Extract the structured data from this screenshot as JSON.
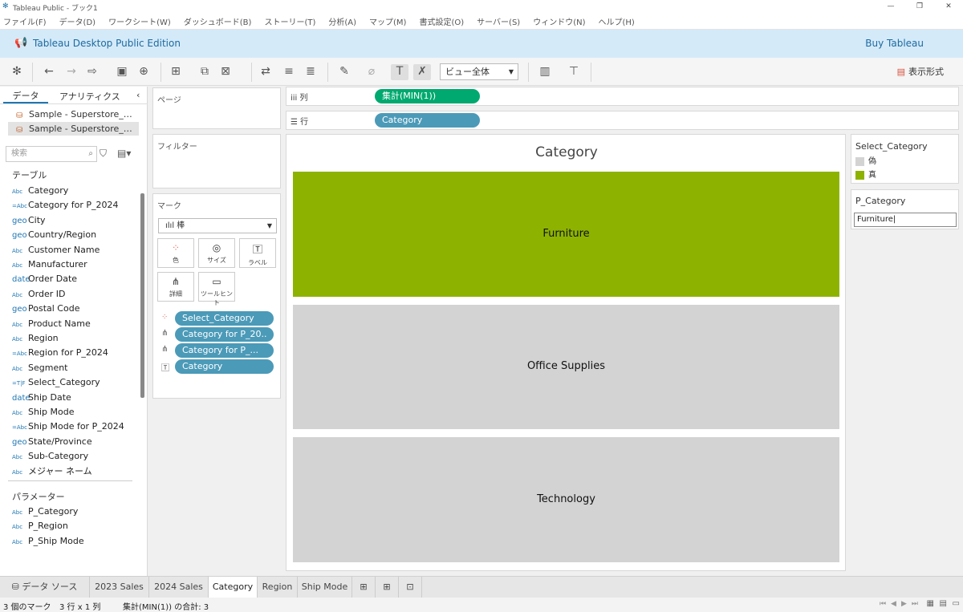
{
  "window": {
    "title": "Tableau Public - ブック1"
  },
  "menu": [
    "ファイル(F)",
    "データ(D)",
    "ワークシート(W)",
    "ダッシュボード(B)",
    "ストーリー(T)",
    "分析(A)",
    "マップ(M)",
    "書式設定(O)",
    "サーバー(S)",
    "ウィンドウ(N)",
    "ヘルプ(H)"
  ],
  "edition": {
    "label": "Tableau Desktop Public Edition",
    "buy": "Buy Tableau"
  },
  "toolbar": {
    "view_select": "ビュー全体",
    "show_me": "表示形式"
  },
  "data_panel": {
    "tab_data": "データ",
    "tab_analytics": "アナリティクス",
    "datasources": [
      "Sample - Superstore_…",
      "Sample - Superstore_…"
    ],
    "search_placeholder": "検索",
    "tables_header": "テーブル",
    "fields": [
      {
        "type": "Abc",
        "name": "Category"
      },
      {
        "type": "=Abc",
        "name": "Category for P_2024"
      },
      {
        "type": "geo",
        "name": "City"
      },
      {
        "type": "geo",
        "name": "Country/Region"
      },
      {
        "type": "Abc",
        "name": "Customer Name"
      },
      {
        "type": "Abc",
        "name": "Manufacturer"
      },
      {
        "type": "date",
        "name": "Order Date"
      },
      {
        "type": "Abc",
        "name": "Order ID"
      },
      {
        "type": "geo",
        "name": "Postal Code"
      },
      {
        "type": "Abc",
        "name": "Product Name"
      },
      {
        "type": "Abc",
        "name": "Region"
      },
      {
        "type": "=Abc",
        "name": "Region for P_2024"
      },
      {
        "type": "Abc",
        "name": "Segment"
      },
      {
        "type": "=T|F",
        "name": "Select_Category"
      },
      {
        "type": "date",
        "name": "Ship Date"
      },
      {
        "type": "Abc",
        "name": "Ship Mode"
      },
      {
        "type": "=Abc",
        "name": "Ship Mode for P_2024"
      },
      {
        "type": "geo",
        "name": "State/Province"
      },
      {
        "type": "Abc",
        "name": "Sub-Category"
      },
      {
        "type": "Abc",
        "name": "メジャー ネーム"
      }
    ],
    "params_header": "パラメーター",
    "params": [
      {
        "type": "Abc",
        "name": "P_Category"
      },
      {
        "type": "Abc",
        "name": "P_Region"
      },
      {
        "type": "Abc",
        "name": "P_Ship Mode"
      }
    ]
  },
  "cards": {
    "pages": "ページ",
    "filters": "フィルター",
    "marks": "マーク",
    "mark_type": "棒",
    "mark_buttons": [
      {
        "icon": "●",
        "label": "色"
      },
      {
        "icon": "◎",
        "label": "サイズ"
      },
      {
        "icon": "T",
        "label": "ラベル"
      },
      {
        "icon": "⋔",
        "label": "詳細"
      },
      {
        "icon": "▭",
        "label": "ツールヒント"
      }
    ],
    "mark_pills": [
      "Select_Category",
      "Category for P_20..",
      "Category for P_...",
      "Category"
    ]
  },
  "shelves": {
    "columns_label": "列",
    "columns_pill": "集計(MIN(1))",
    "rows_label": "行",
    "rows_pill": "Category"
  },
  "viz": {
    "title": "Category"
  },
  "chart_data": {
    "type": "bar",
    "title": "Category",
    "categories": [
      "Furniture",
      "Office Supplies",
      "Technology"
    ],
    "values": [
      1,
      1,
      1
    ],
    "color_field": "Select_Category",
    "colors_by_category": [
      "#8db300",
      "#d3d3d3",
      "#d3d3d3"
    ],
    "xlabel": "",
    "ylabel": ""
  },
  "legend": {
    "title": "Select_Category",
    "items": [
      {
        "label": "偽",
        "color": "#d3d3d3"
      },
      {
        "label": "真",
        "color": "#8db300"
      }
    ]
  },
  "parameter": {
    "title": "P_Category",
    "value": "Furniture|"
  },
  "sheet_tabs": [
    "データ ソース",
    "2023 Sales",
    "2024 Sales",
    "Category",
    "Region",
    "Ship Mode"
  ],
  "status": {
    "marks": "3 個のマーク",
    "dims": "3 行 x 1 列",
    "sum": "集計(MIN(1)) の合計: 3"
  }
}
